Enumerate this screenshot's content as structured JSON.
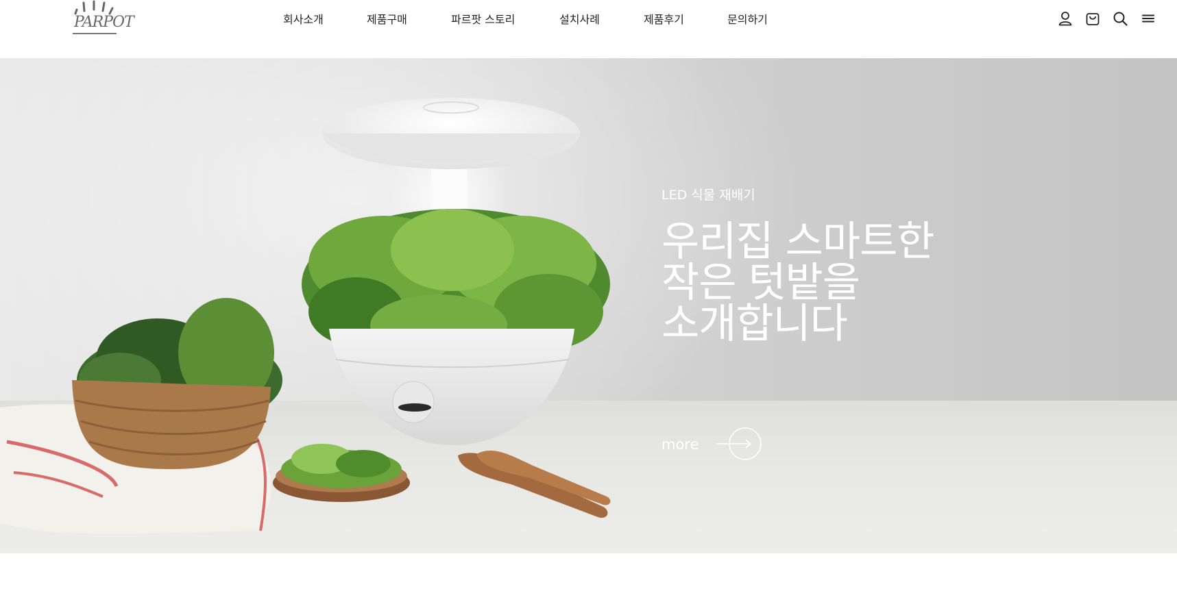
{
  "brand": {
    "name": "PARPOT"
  },
  "nav": {
    "items": [
      {
        "label": "회사소개"
      },
      {
        "label": "제품구매"
      },
      {
        "label": "파르팟 스토리"
      },
      {
        "label": "설치사례"
      },
      {
        "label": "제품후기"
      },
      {
        "label": "문의하기"
      }
    ]
  },
  "header_icons": [
    "user-icon",
    "cart-icon",
    "search-icon",
    "menu-icon"
  ],
  "hero": {
    "subtitle": "LED 식물 재배기",
    "headline": [
      "우리집 스마트한",
      "작은 텃밭을",
      "소개합니다"
    ],
    "more_label": "more"
  },
  "colors": {
    "hero_text": "#ffffff",
    "header_bg": "#ffffff",
    "nav_text": "#222222"
  }
}
